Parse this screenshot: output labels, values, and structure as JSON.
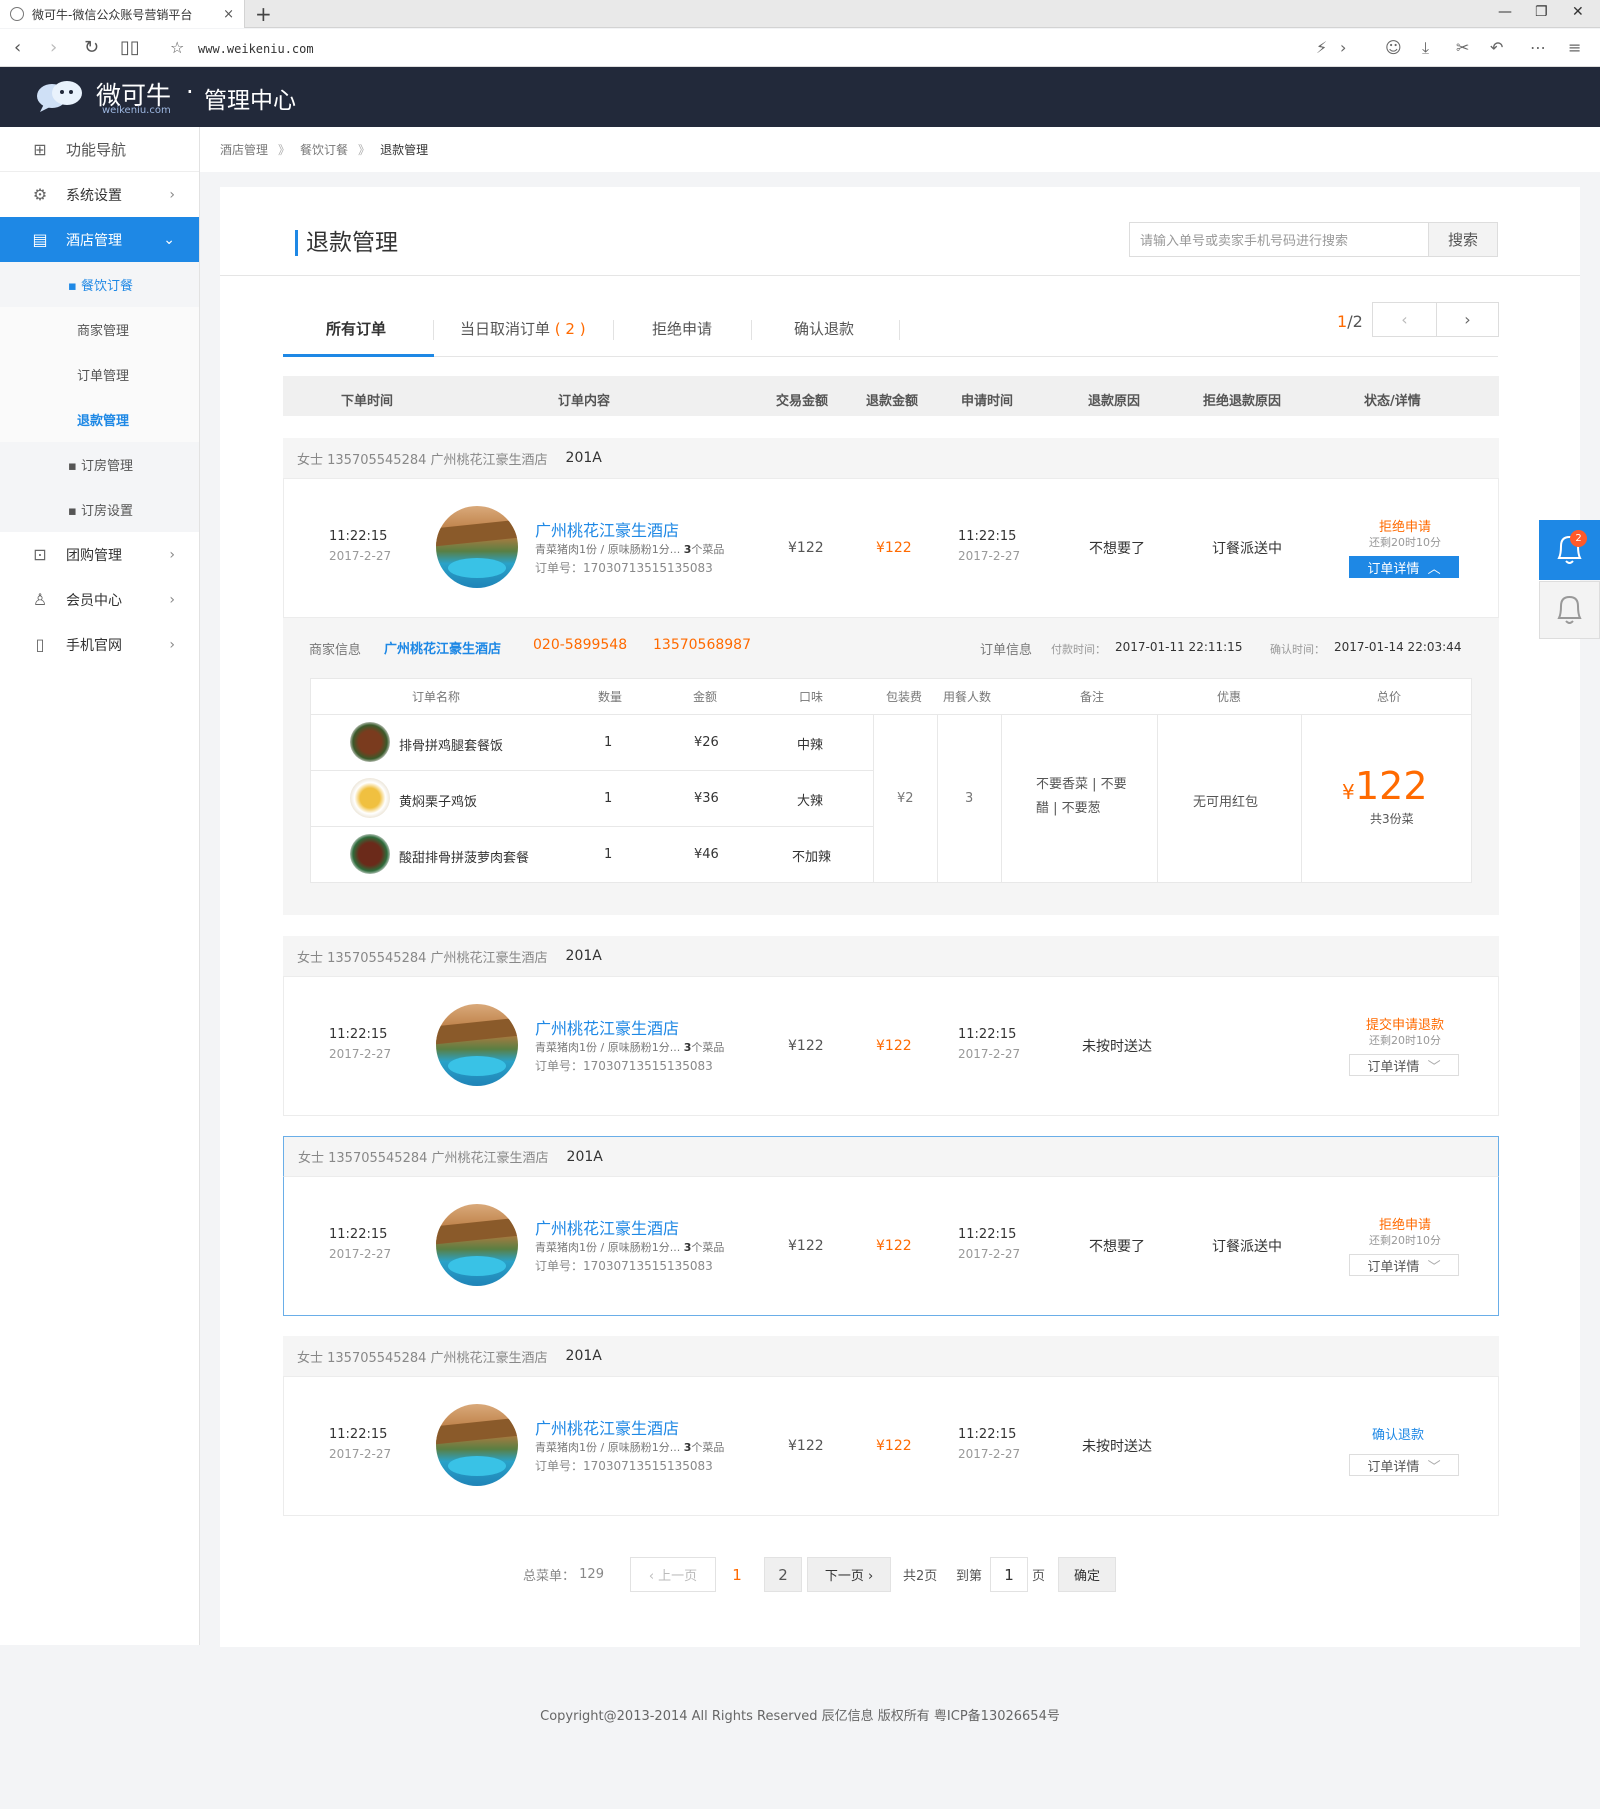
{
  "browser": {
    "tab_title": "微可牛-微信公众账号营销平台",
    "tab_close": "×",
    "new_tab": "+",
    "url": "www.weikeniu.com",
    "win_min": "—",
    "win_restore": "❐",
    "win_close": "✕"
  },
  "header": {
    "logo_cn": "微可牛",
    "logo_en": "weikeniu.com",
    "logo_dot": "·",
    "center": "管理中心"
  },
  "sidebar": {
    "items": [
      {
        "label": "功能导航",
        "icon": "grid-icon"
      },
      {
        "label": "系统设置",
        "icon": "gear-icon"
      },
      {
        "label": "酒店管理",
        "icon": "hotel-icon"
      },
      {
        "label": "团购管理",
        "icon": "gift-icon"
      },
      {
        "label": "会员中心",
        "icon": "user-vip-icon"
      },
      {
        "label": "手机官网",
        "icon": "phone-icon"
      }
    ],
    "sub": {
      "canyin": "▪ 餐饮订餐",
      "shangjia": "商家管理",
      "dingdan": "订单管理",
      "tuikuan": "退款管理",
      "dingfang": "▪ 订房管理",
      "dingfangset": "▪ 订房设置"
    },
    "chevron": "›",
    "chevron_down": "⌄"
  },
  "breadcrumb": {
    "a": "酒店管理",
    "b": "餐饮订餐",
    "c": "退款管理",
    "sep": "》"
  },
  "page": {
    "title": "退款管理",
    "search_placeholder": "请输入单号或卖家手机号码进行搜索",
    "search_btn": "搜索"
  },
  "tabs": {
    "all": "所有订单",
    "today_cancel": "当日取消订单",
    "today_count": "( 2 )",
    "reject": "拒绝申请",
    "confirm": "确认退款"
  },
  "pager": {
    "current": "1",
    "total": "/2",
    "prev": "‹",
    "next": "›"
  },
  "columns": {
    "c1": "下单时间",
    "c2": "订单内容",
    "c3": "交易金额",
    "c4": "退款金额",
    "c5": "申请时间",
    "c6": "退款原因",
    "c7": "拒绝退款原因",
    "c8": "状态/详情"
  },
  "orders": [
    {
      "buyer": "女士  135705545284   广州桃花江豪生酒店",
      "room": "201A",
      "time": "11:22:15",
      "date": "2017-2-27",
      "hotel": "广州桃花江豪生酒店",
      "items": "青菜猪肉1份 / 原味肠粉1分...",
      "count": "3",
      "count_unit": "个菜品",
      "order_no": "订单号：17030713515135083",
      "amount": "¥122",
      "refund": "¥122",
      "apply_time": "11:22:15",
      "apply_date": "2017-2-27",
      "reason": "不想要了",
      "reject_reason": "订餐派送中",
      "status": "拒绝申请",
      "remain": "还剩20时10分",
      "detail": "订单详情",
      "detail_arrow": "︿"
    },
    {
      "buyer": "女士  135705545284   广州桃花江豪生酒店",
      "room": "201A",
      "time": "11:22:15",
      "date": "2017-2-27",
      "hotel": "广州桃花江豪生酒店",
      "items": "青菜猪肉1份 / 原味肠粉1分...",
      "count": "3",
      "count_unit": "个菜品",
      "order_no": "订单号：17030713515135083",
      "amount": "¥122",
      "refund": "¥122",
      "apply_time": "11:22:15",
      "apply_date": "2017-2-27",
      "reason": "未按时送达",
      "reject_reason": "",
      "status": "提交申请退款",
      "remain": "还剩20时10分",
      "detail": "订单详情",
      "detail_arrow": "﹀"
    },
    {
      "buyer": "女士  135705545284   广州桃花江豪生酒店",
      "room": "201A",
      "time": "11:22:15",
      "date": "2017-2-27",
      "hotel": "广州桃花江豪生酒店",
      "items": "青菜猪肉1份 / 原味肠粉1分...",
      "count": "3",
      "count_unit": "个菜品",
      "order_no": "订单号：17030713515135083",
      "amount": "¥122",
      "refund": "¥122",
      "apply_time": "11:22:15",
      "apply_date": "2017-2-27",
      "reason": "不想要了",
      "reject_reason": "订餐派送中",
      "status": "拒绝申请",
      "remain": "还剩20时10分",
      "detail": "订单详情",
      "detail_arrow": "﹀"
    },
    {
      "buyer": "女士  135705545284   广州桃花江豪生酒店",
      "room": "201A",
      "time": "11:22:15",
      "date": "2017-2-27",
      "hotel": "广州桃花江豪生酒店",
      "items": "青菜猪肉1份 / 原味肠粉1分...",
      "count": "3",
      "count_unit": "个菜品",
      "order_no": "订单号：17030713515135083",
      "amount": "¥122",
      "refund": "¥122",
      "apply_time": "11:22:15",
      "apply_date": "2017-2-27",
      "reason": "未按时送达",
      "reject_reason": "",
      "status": "确认退款",
      "remain": "",
      "detail": "订单详情",
      "detail_arrow": "﹀"
    }
  ],
  "detail": {
    "merchant_label": "商家信息",
    "merchant_name": "广州桃花江豪生酒店",
    "phone1": "020-5899548",
    "phone2": "13570568987",
    "order_info_label": "订单信息",
    "pay_label": "付款时间：",
    "pay_time": "2017-01-11 22:11:15",
    "confirm_label": "确认时间：",
    "confirm_time": "2017-01-14 22:03:44",
    "headers": {
      "name": "订单名称",
      "qty": "数量",
      "amount": "金额",
      "taste": "口味",
      "pack": "包装费",
      "people": "用餐人数",
      "note": "备注",
      "discount": "优惠",
      "total": "总价"
    },
    "rows": [
      {
        "name": "排骨拼鸡腿套餐饭",
        "qty": "1",
        "amount": "¥26",
        "taste": "中辣"
      },
      {
        "name": "黄焖栗子鸡饭",
        "qty": "1",
        "amount": "¥36",
        "taste": "大辣"
      },
      {
        "name": "酸甜排骨拼菠萝肉套餐",
        "qty": "1",
        "amount": "¥46",
        "taste": "不加辣"
      }
    ],
    "pack": "¥2",
    "people": "3",
    "note_line1": "不要香菜 | 不要",
    "note_line2": "醋 | 不要葱",
    "discount": "无可用红包",
    "total_sym": "¥",
    "total": "122",
    "total_sub": "共3份菜"
  },
  "pagination": {
    "total_label": "总菜单：",
    "total": "129",
    "prev": "‹ 上一页",
    "p1": "1",
    "p2": "2",
    "next": "下一页 ›",
    "pages": "共2页",
    "goto": "到第",
    "goto_val": "1",
    "page_unit": "页",
    "confirm": "确定"
  },
  "notifications": {
    "badge": "2"
  },
  "footer": "Copyright@2013-2014 All Rights Reserved 辰亿信息 版权所有  粤ICP备13026654号",
  "colors": {
    "accent": "#1e88e5",
    "orange": "#ff6a00",
    "header_bg": "#22293a"
  }
}
